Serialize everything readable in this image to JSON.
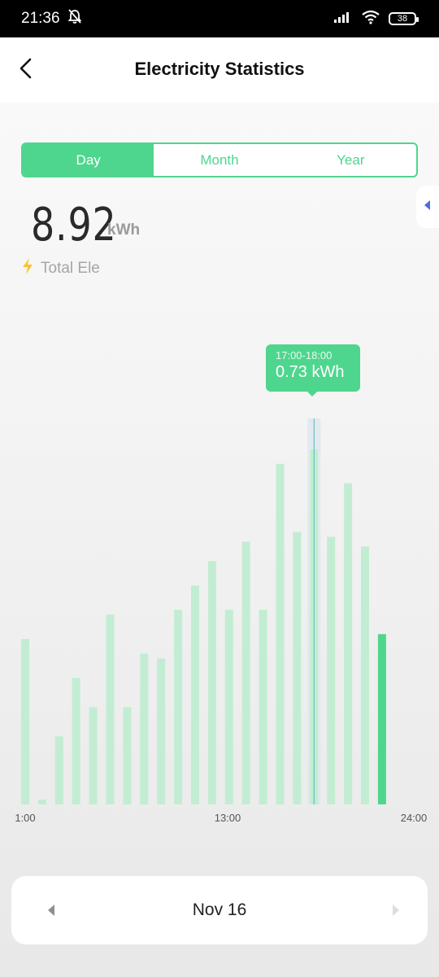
{
  "status_bar": {
    "time": "21:36",
    "battery": "38",
    "icons": [
      "alarm-off-icon",
      "signal-icon",
      "wifi-icon",
      "battery-icon"
    ]
  },
  "header": {
    "title": "Electricity Statistics",
    "back_icon": "chevron-left-icon"
  },
  "tabs": [
    {
      "label": "Day",
      "active": true
    },
    {
      "label": "Month",
      "active": false
    },
    {
      "label": "Year",
      "active": false
    }
  ],
  "summary": {
    "value": "8.92",
    "unit": "kWh",
    "label": "Total Ele",
    "icon": "lightning-icon"
  },
  "tooltip": {
    "time_range": "17:00-18:00",
    "value": "0.73 kWh"
  },
  "date_nav": {
    "label": "Nov 16",
    "prev_icon": "triangle-left-icon",
    "next_icon": "triangle-right-icon"
  },
  "colors": {
    "accent": "#4fd68e",
    "bar_light": "#c2edd3",
    "tooltip_text": "#ffffff"
  },
  "chart_data": {
    "type": "bar",
    "categories": [
      "1",
      "2",
      "3",
      "4",
      "5",
      "6",
      "7",
      "8",
      "9",
      "10",
      "11",
      "12",
      "13",
      "14",
      "15",
      "16",
      "17",
      "18",
      "19",
      "20",
      "21",
      "22"
    ],
    "values": [
      0.34,
      0.01,
      0.14,
      0.26,
      0.2,
      0.39,
      0.2,
      0.31,
      0.3,
      0.4,
      0.45,
      0.5,
      0.4,
      0.54,
      0.4,
      0.7,
      0.56,
      0.73,
      0.55,
      0.66,
      0.53,
      0.35
    ],
    "highlight_index": 17,
    "current_index": 21,
    "x_tick_labels": [
      "1:00",
      "13:00",
      "24:00"
    ],
    "title": "",
    "xlabel": "",
    "ylabel": "",
    "ylim": [
      0,
      0.8
    ],
    "grid": false
  }
}
